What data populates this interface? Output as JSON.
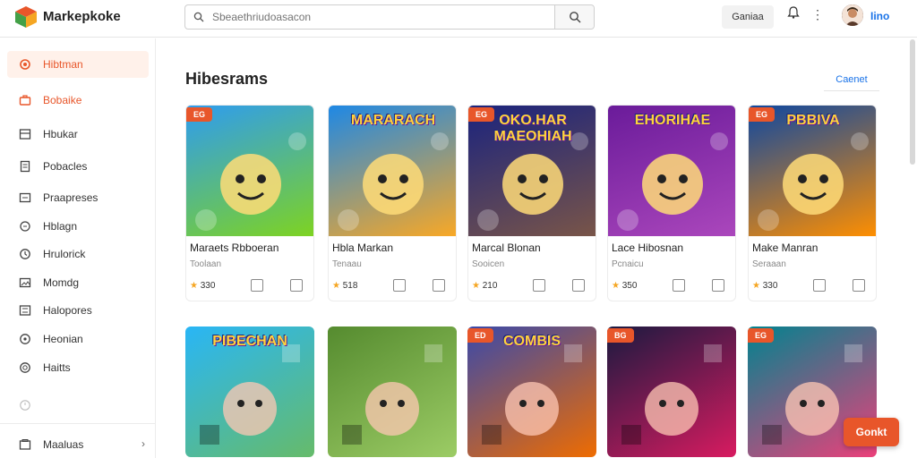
{
  "app": {
    "name": "Markepkoke",
    "username": "Iino"
  },
  "header": {
    "search_placeholder": "Sbeaethriudoasacon",
    "games_label": "Ganiaa"
  },
  "sidebar": {
    "items": [
      {
        "label": "Hibtman",
        "icon": "gear-icon",
        "active": true
      },
      {
        "label": "Bobaike",
        "icon": "briefcase-icon",
        "highlight": true
      },
      {
        "label": "Hbukar",
        "icon": "grid-icon"
      },
      {
        "label": "Pobacles",
        "icon": "document-icon"
      },
      {
        "label": "Praapreses",
        "icon": "list-icon"
      },
      {
        "label": "Hblagn",
        "icon": "chat-icon"
      },
      {
        "label": "Hrulorick",
        "icon": "clock-icon"
      },
      {
        "label": "Momdg",
        "icon": "image-icon"
      },
      {
        "label": "Halopores",
        "icon": "sliders-icon"
      },
      {
        "label": "Heonian",
        "icon": "target-icon"
      },
      {
        "label": "Haitts",
        "icon": "help-icon"
      },
      {
        "label": "",
        "icon": "clock-small-icon"
      }
    ],
    "footer_label": "Maaluas"
  },
  "main": {
    "section_title": "Hibesrams",
    "see_all_label": "Caenet",
    "row1": [
      {
        "badge": "EG",
        "thumb_text": "",
        "title": "Maraets Rbboeran",
        "sub": "Toolaan",
        "rating": "330",
        "colors": [
          "#2e9cf0",
          "#7ed321"
        ]
      },
      {
        "badge": "",
        "thumb_text": "MARARACH",
        "title": "Hbla Markan",
        "sub": "Tenaau",
        "rating": "518",
        "colors": [
          "#1e88e5",
          "#f9a825"
        ]
      },
      {
        "badge": "EG",
        "thumb_text": "OKO.HAR MAEOHIAH",
        "title": "Marcal Blonan",
        "sub": "Sooicen",
        "rating": "210",
        "colors": [
          "#1a237e",
          "#795548"
        ]
      },
      {
        "badge": "",
        "thumb_text": "EHORIHAE",
        "title": "Lace Hibosnan",
        "sub": "Pcnaicu",
        "rating": "350",
        "colors": [
          "#6a1b9a",
          "#ab47bc"
        ]
      },
      {
        "badge": "EG",
        "thumb_text": "PBBIVA",
        "title": "Make Manran",
        "sub": "Seraaan",
        "rating": "330",
        "colors": [
          "#0d47a1",
          "#ff8f00"
        ]
      }
    ],
    "row2": [
      {
        "badge": "",
        "thumb_text": "PIBECHAN",
        "tag": "",
        "colors": [
          "#29b6f6",
          "#66bb6a"
        ]
      },
      {
        "badge": "",
        "thumb_text": "",
        "tag": "",
        "colors": [
          "#558b2f",
          "#9ccc65"
        ]
      },
      {
        "badge": "ED",
        "thumb_text": "COMBIS",
        "tag": "",
        "colors": [
          "#3949ab",
          "#ef6c00"
        ]
      },
      {
        "badge": "BG",
        "thumb_text": "",
        "tag": "",
        "colors": [
          "#1a1a40",
          "#d81b60"
        ]
      },
      {
        "badge": "EG",
        "thumb_text": "",
        "tag": "",
        "colors": [
          "#00838f",
          "#ec407a"
        ]
      }
    ]
  },
  "chat_button_label": "Gonkt"
}
